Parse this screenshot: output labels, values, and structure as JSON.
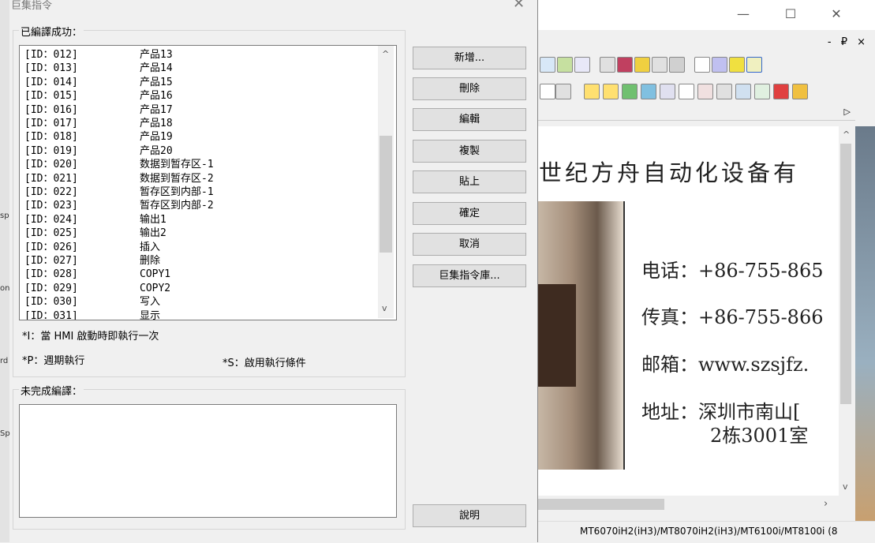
{
  "dialog": {
    "title": "巨集指令",
    "close_glyph": "✕",
    "compiled_label": "已編譯成功：",
    "uncompiled_label": "未完成編譯：",
    "notes": {
      "i": "*I：當 HMI 啟動時即執行一次",
      "p": "*P：週期執行",
      "s": "*S：啟用執行條件"
    },
    "buttons": {
      "add": "新增...",
      "delete": "刪除",
      "edit": "編輯",
      "copy": "複製",
      "paste": "貼上",
      "ok": "確定",
      "cancel": "取消",
      "library": "巨集指令庫...",
      "help": "說明"
    },
    "macros": [
      {
        "id": "[ID：012]",
        "name": "产品13"
      },
      {
        "id": "[ID：013]",
        "name": "产品14"
      },
      {
        "id": "[ID：014]",
        "name": "产品15"
      },
      {
        "id": "[ID：015]",
        "name": "产品16"
      },
      {
        "id": "[ID：016]",
        "name": "产品17"
      },
      {
        "id": "[ID：017]",
        "name": "产品18"
      },
      {
        "id": "[ID：018]",
        "name": "产品19"
      },
      {
        "id": "[ID：019]",
        "name": "产品20"
      },
      {
        "id": "[ID：020]",
        "name": "数据到暂存区-1"
      },
      {
        "id": "[ID：021]",
        "name": "数据到暂存区-2"
      },
      {
        "id": "[ID：022]",
        "name": "暂存区到内部-1"
      },
      {
        "id": "[ID：023]",
        "name": "暂存区到内部-2"
      },
      {
        "id": "[ID：024]",
        "name": "输出1"
      },
      {
        "id": "[ID：025]",
        "name": "输出2"
      },
      {
        "id": "[ID：026]",
        "name": "插入"
      },
      {
        "id": "[ID：027]",
        "name": "删除"
      },
      {
        "id": "[ID：028]",
        "name": "COPY1"
      },
      {
        "id": "[ID：029]",
        "name": "COPY2"
      },
      {
        "id": "[ID：030]",
        "name": "写入"
      },
      {
        "id": "[ID：031]",
        "name": "显示"
      }
    ]
  },
  "background": {
    "company_text": "世纪方舟自动化设备有",
    "phone": "电话：+86-755-865",
    "fax": "传真：+86-755-866",
    "email": "邮箱：www.szsjfz.",
    "address1": "地址：深圳市南山[",
    "address2": "2栋3001室",
    "status": "MT6070iH2(iH3)/MT8070iH2(iH3)/MT6100i/MT8100i (8",
    "window_buttons": {
      "minimize": "—",
      "maximize": "☐",
      "close": "✕"
    },
    "mdi_buttons": "- ₽ ×"
  },
  "colors": {
    "dialog_bg": "#f0f0f0",
    "list_bg": "#ffffff",
    "button_bg": "#e1e1e1"
  }
}
